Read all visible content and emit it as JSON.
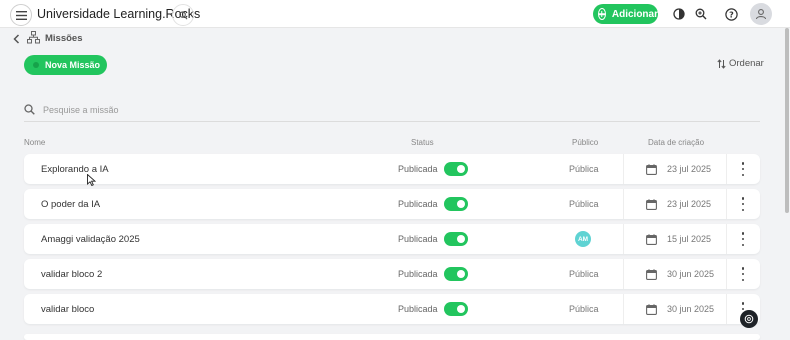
{
  "topbar": {
    "title": "Universidade Learning.Rocks",
    "add_label": "Adicionar",
    "icons": [
      "menu-icon",
      "search-icon",
      "contrast-icon",
      "zoom-icon",
      "help-icon",
      "user-icon"
    ]
  },
  "breadcrumb": {
    "label": "Missões",
    "icon": "hierarchy-icon"
  },
  "actions": {
    "new_label": "Nova Missão",
    "sort_label": "Ordenar"
  },
  "search": {
    "placeholder": "Pesquise a missão"
  },
  "table": {
    "columns": {
      "name": "Nome",
      "status": "Status",
      "public": "Público",
      "date": "Data de criação"
    },
    "rows": [
      {
        "name": "Explorando a IA",
        "status": "Publicada",
        "public": "Pública",
        "date": "23 jul 2025"
      },
      {
        "name": "O poder da IA",
        "status": "Publicada",
        "public": "Pública",
        "date": "23 jul 2025"
      },
      {
        "name": "Amaggi validação 2025",
        "status": "Publicada",
        "public_avatar": "AM",
        "date": "15 jul 2025"
      },
      {
        "name": "validar bloco 2",
        "status": "Publicada",
        "public": "Pública",
        "date": "30 jun 2025"
      },
      {
        "name": "validar bloco",
        "status": "Publicada",
        "public": "Pública",
        "date": "30 jun 2025"
      }
    ]
  },
  "colors": {
    "accent": "#22c55e",
    "background": "#f2f3f5",
    "avatar": "#5fd3d3"
  }
}
